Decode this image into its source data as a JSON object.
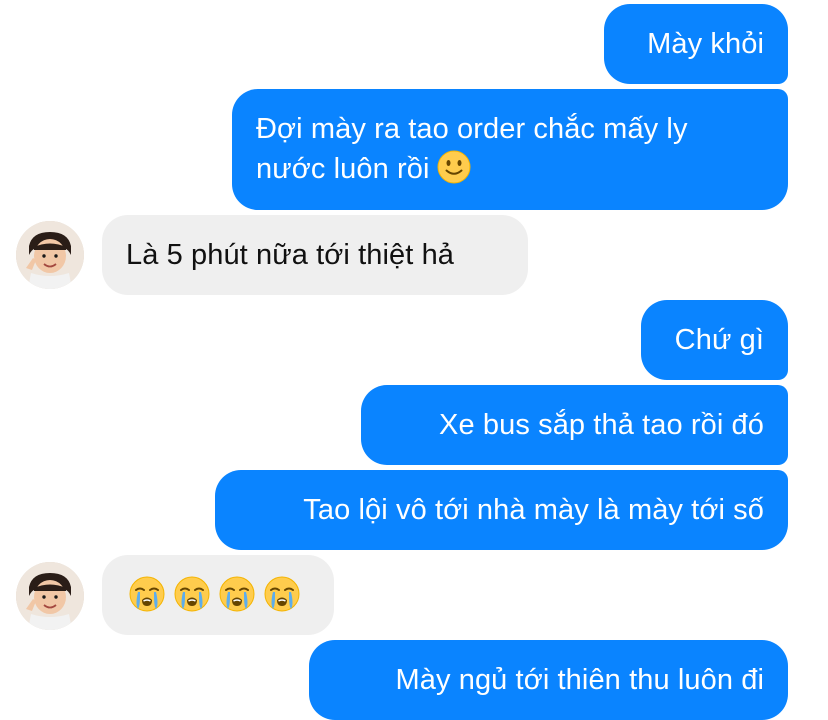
{
  "conversation": {
    "messages": [
      {
        "side": "outgoing",
        "text": "Mày khỏi"
      },
      {
        "side": "outgoing",
        "text_line1": "Đợi mày ra tao order chắc mấy ly",
        "text_line2": "nước luôn rồi",
        "emoji": "slightly-smiling-face"
      },
      {
        "side": "incoming",
        "text": "Là 5 phút nữa tới thiệt hả"
      },
      {
        "side": "outgoing",
        "text": "Chứ gì"
      },
      {
        "side": "outgoing",
        "text": "Xe bus sắp thả tao rồi đó"
      },
      {
        "side": "outgoing",
        "text": "Tao lội vô tới nhà mày là mày tới số"
      },
      {
        "side": "incoming",
        "emoji": [
          "loudly-crying-face",
          "loudly-crying-face",
          "loudly-crying-face",
          "loudly-crying-face"
        ]
      },
      {
        "side": "outgoing",
        "text": "Mày ngủ tới thiên thu luôn đi"
      }
    ]
  },
  "colors": {
    "outgoing_bubble": "#0a84ff",
    "incoming_bubble": "#efefef",
    "outgoing_text": "#ffffff",
    "incoming_text": "#111111"
  },
  "icons": {
    "contact_avatar": "contact-avatar",
    "smile_emoji": "slightly-smiling-face-icon",
    "cry_emoji": "loudly-crying-face-icon"
  }
}
